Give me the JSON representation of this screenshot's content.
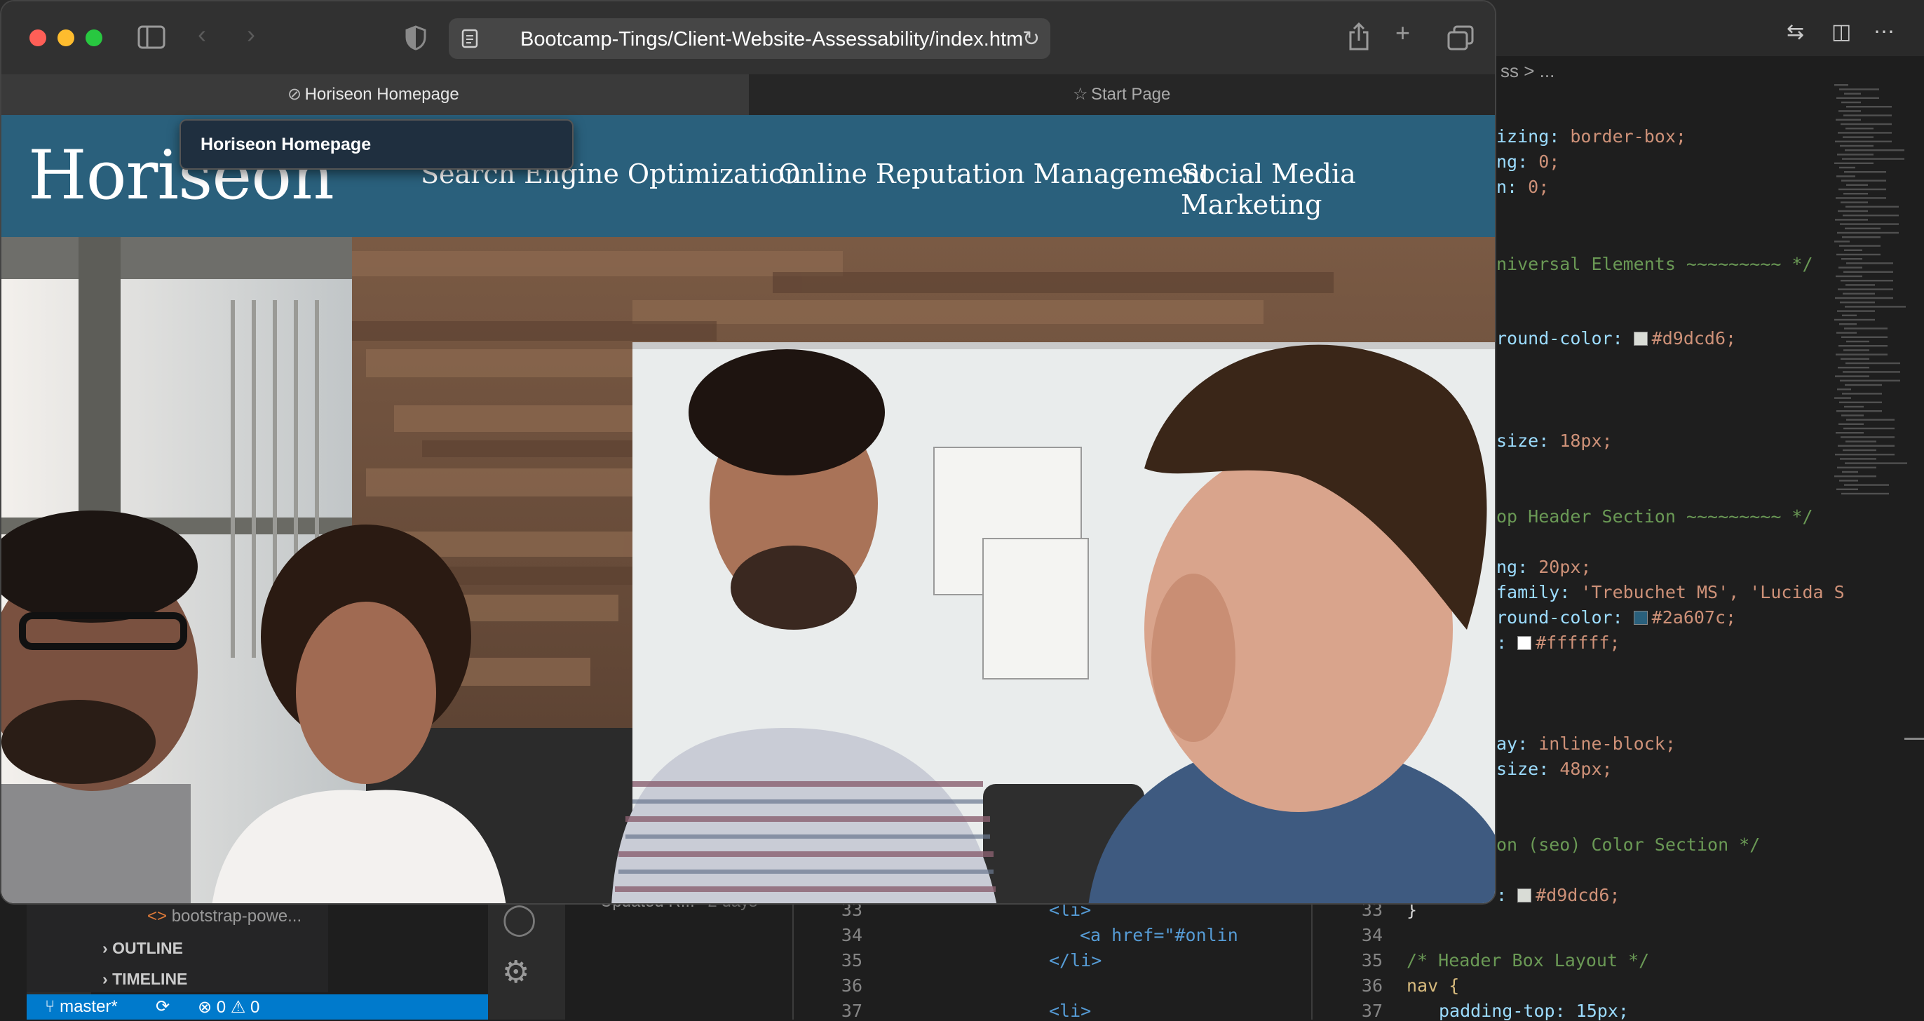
{
  "browser": {
    "url": "Bootcamp-Tings/Client-Website-Assessability/index.html",
    "tabs": [
      {
        "label": "Horiseon Homepage",
        "active": true
      },
      {
        "label": "Start Page",
        "active": false
      }
    ],
    "tooltip": "Horiseon Homepage"
  },
  "site": {
    "logo": "Horiseon",
    "nav": [
      "Search Engine Optimization",
      "Online Reputation Management",
      "Social Media Marketing"
    ],
    "header_color": "#2a607c"
  },
  "editor": {
    "breadcrumb": "ss > ...",
    "right_code": [
      {
        "text": "izing: ",
        "val": "border-box;"
      },
      {
        "text": "ng: ",
        "val": "0;"
      },
      {
        "text": "n: ",
        "val": "0;"
      },
      {
        "comment": "niversal Elements ~~~~~~~~~ */"
      },
      {
        "text": "round-color: ",
        "swatch": "#d9dcd6",
        "val": "#d9dcd6;"
      },
      {
        "text": "size: ",
        "val": "18px;"
      },
      {
        "comment": "op Header Section ~~~~~~~~~ */"
      },
      {
        "text": "ng: ",
        "val": "20px;"
      },
      {
        "text": "family: ",
        "val": "'Trebuchet MS', 'Lucida S"
      },
      {
        "text": "round-color: ",
        "swatch": "#2a607c",
        "val": "#2a607c;"
      },
      {
        "text": ": ",
        "swatch": "#ffffff",
        "val": "#ffffff;"
      },
      {
        "text": "ay: ",
        "val": "inline-block;"
      },
      {
        "text": "size: ",
        "val": "48px;"
      },
      {
        "comment": "on (seo) Color Section */"
      },
      {
        "text": ": ",
        "swatch": "#d9dcd6",
        "val": "#d9dcd6;"
      }
    ],
    "closing_brace": "}",
    "sidebar": {
      "file_item": "bootstrap-powe...",
      "outline": "OUTLINE",
      "timeline": "TIMELINE"
    },
    "commit_text": "Updated R...",
    "commit_time": "2 days",
    "status": {
      "branch": "master*",
      "errors": "0",
      "warnings": "0"
    },
    "pane_a_lines": [
      "33",
      "34",
      "35",
      "36",
      "37"
    ],
    "pane_a_code": [
      "<li>",
      "<a href=\"#onlin",
      "</li>",
      "",
      "<li>"
    ],
    "pane_b_lines": [
      "33",
      "34",
      "35",
      "36",
      "37"
    ],
    "pane_b_code": [
      "}",
      "",
      "/* Header Box Layout */",
      "nav {",
      "padding-top: 15px;"
    ]
  }
}
